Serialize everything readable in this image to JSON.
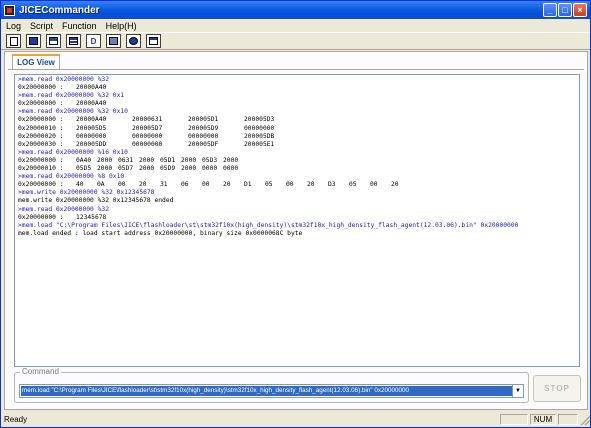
{
  "window": {
    "title": "JICECommander"
  },
  "menu": [
    "Log",
    "Script",
    "Function",
    "Help(H)"
  ],
  "toolbar": {
    "buttons": [
      "new-icon",
      "save-icon",
      "load-icon",
      "list-icon",
      "d-icon",
      "picture-icon",
      "chip-icon",
      "window-icon"
    ],
    "d_glyph": "D"
  },
  "tabs": [
    {
      "label": "LOG View"
    }
  ],
  "log": [
    {
      "cmd": true,
      "text": ">mem.read 0x20000000 %32"
    },
    {
      "cmd": false,
      "cols": [
        "0x20000000 :",
        "20000A40"
      ]
    },
    {
      "cmd": true,
      "text": ">mem.read 0x20000000 %32 0x1"
    },
    {
      "cmd": false,
      "cols": [
        "0x20000000 :",
        "20000A40"
      ]
    },
    {
      "cmd": true,
      "text": ">mem.read 0x20000000 %32 0x10"
    },
    {
      "cmd": false,
      "cols": [
        "0x20000000 :",
        "20000A40",
        "20000631",
        "200005D1",
        "200005D3"
      ]
    },
    {
      "cmd": false,
      "cols": [
        "0x20000010 :",
        "200005D5",
        "200005D7",
        "200005D9",
        "00000000"
      ]
    },
    {
      "cmd": false,
      "cols": [
        "0x20000020 :",
        "00000000",
        "00000000",
        "00000000",
        "200005DB"
      ]
    },
    {
      "cmd": false,
      "cols": [
        "0x20000030 :",
        "200005DD",
        "00000000",
        "200005DF",
        "200005E1"
      ]
    },
    {
      "cmd": true,
      "text": ">mem.read 0x20000000 %16 0x10"
    },
    {
      "cmd": false,
      "cols": [
        "0x20000000 :",
        "0A40",
        "2000",
        "0631",
        "2000",
        "05D1",
        "2000",
        "05D3",
        "2000"
      ]
    },
    {
      "cmd": false,
      "cols": [
        "0x20000010 :",
        "05D5",
        "2000",
        "05D7",
        "2000",
        "05D9",
        "2000",
        "0000",
        "0000"
      ]
    },
    {
      "cmd": true,
      "text": ">mem.read 0x20000000 %8 0x10"
    },
    {
      "cmd": false,
      "cols": [
        "0x20000000 :",
        "40",
        "0A",
        "00",
        "20",
        "31",
        "06",
        "00",
        "20",
        "D1",
        "05",
        "00",
        "20",
        "D3",
        "05",
        "00",
        "20"
      ]
    },
    {
      "cmd": true,
      "text": ">mem.write 0x20000000 %32 0x12345678"
    },
    {
      "cmd": false,
      "text": "mem.write 0x20000000 %32 0x12345678 ended"
    },
    {
      "cmd": true,
      "text": ">mem.read 0x20000000 %32"
    },
    {
      "cmd": false,
      "cols": [
        "0x20000000 :",
        "12345678"
      ]
    },
    {
      "cmd": true,
      "text": ">mem.load \"C:\\Program Files\\JICE\\flashloader\\st\\stm32f10x(high_density)\\stm32f10x_high_density_flash_agent(12.03.06).bin\" 0x20000000"
    },
    {
      "cmd": false,
      "text": "mem.load ended : load start address 0x20000000, binary size 0x0000068C byte"
    }
  ],
  "command": {
    "label": "Command",
    "value": "mem.load \"C:\\Program Files\\JICE\\flashloader\\st\\stm32f10x(high_density)\\stm32f10x_high_density_flash_agent(12.03.06).bin\" 0x20000000",
    "dropdown_glyph": "▼"
  },
  "stop_label": "STOP",
  "status": {
    "text": "Ready",
    "panes": [
      "",
      "NUM",
      ""
    ]
  },
  "colors": {
    "command_text": "#2020d0",
    "selection": "#316ac5",
    "title_bar": "#0a5ee0"
  }
}
